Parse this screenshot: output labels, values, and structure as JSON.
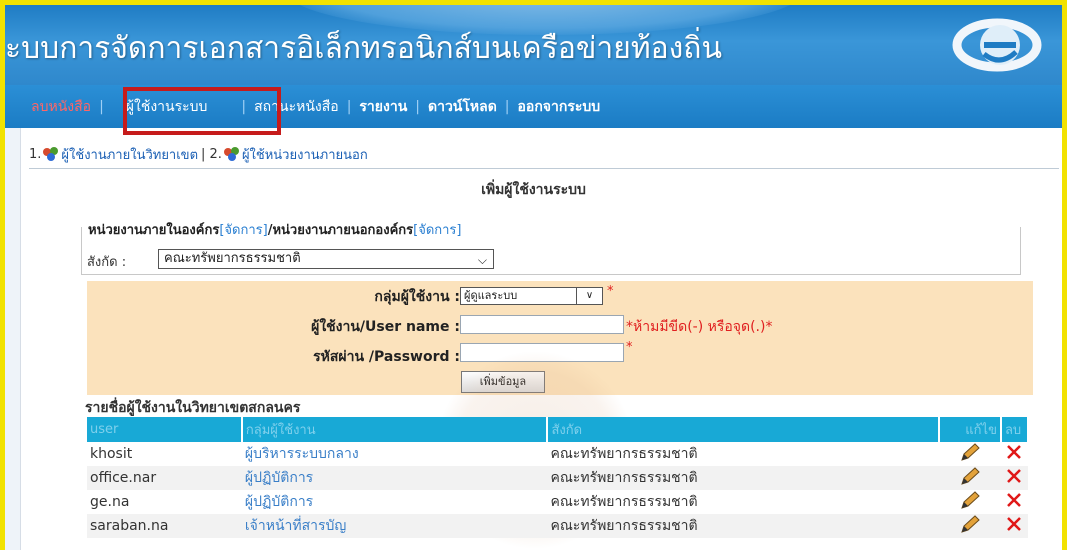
{
  "banner": {
    "title": "ะบบการจัดการเอกสารอิเล็กทรอนิกส์บนเครือข่ายท้องถิ่น"
  },
  "nav": {
    "items": [
      {
        "label": "ลบหนังสือ"
      },
      {
        "label": "ผู้ใช้งานระบบ"
      },
      {
        "label": "สถานะหนังสือ"
      },
      {
        "label": "รายงาน"
      },
      {
        "label": "ดาวน์โหลด"
      },
      {
        "label": "ออกจากระบบ"
      }
    ]
  },
  "tabs": {
    "tab1_num": "1.",
    "tab1_label": "ผู้ใช้งานภายในวิทยาเขต",
    "divider": " | 2.",
    "tab2_label": "ผู้ใช้หน่วยงานภายนอก"
  },
  "section_title": "เพิ่มผู้ใช้งานระบบ",
  "org": {
    "legend_a": "หน่วยงานภายในองค์กร",
    "link1": "[จัดการ]",
    "legend_b": "/หน่วยงานภายนอกองค์กร",
    "link2": "[จัดการ]",
    "label": "สังกัด :",
    "selected": "คณะทรัพยากรธรรมชาติ"
  },
  "form": {
    "group_label": "กลุ่มผู้ใช้งาน :",
    "group_selected": "ผู้ดูแลระบบ",
    "username_label": "ผู้ใช้งาน/User name :",
    "username_value": "",
    "username_hint": "*ห้ามมีขีด(-) หรือจุด(.)*",
    "password_label": "รหัสผ่าน /Password :",
    "password_value": "",
    "required_mark": "*",
    "add_button": "เพิ่มข้อมูล"
  },
  "list": {
    "title": "รายชื่อผู้ใช้งานในวิทยาเขตสกลนคร",
    "columns": [
      "user",
      "กลุ่มผู้ใช้งาน",
      "สังกัด",
      "แก้ไข",
      "ลบ"
    ],
    "rows": [
      {
        "user": "khosit",
        "group": "ผู้บริหารระบบกลาง",
        "org": "คณะทรัพยากรธรรมชาติ"
      },
      {
        "user": "office.nar",
        "group": "ผู้ปฏิบัติการ",
        "org": "คณะทรัพยากรธรรมชาติ"
      },
      {
        "user": "ge.na",
        "group": "ผู้ปฏิบัติการ",
        "org": "คณะทรัพยากรธรรมชาติ"
      },
      {
        "user": "saraban.na",
        "group": "เจ้าหน้าที่สารบัญ",
        "org": "คณะทรัพยากรธรรมชาติ"
      }
    ]
  },
  "icons": {
    "edit": "pencil-icon",
    "delete": "red-x-icon",
    "tab": "users-group-icon",
    "logo": "internet-explorer-logo"
  },
  "colors": {
    "nav_bg": "#1b7cc4",
    "highlight_box": "#c61b1b",
    "table_header": "#18a9d6",
    "form_bg": "#fbe2bc",
    "required": "#e02020"
  }
}
